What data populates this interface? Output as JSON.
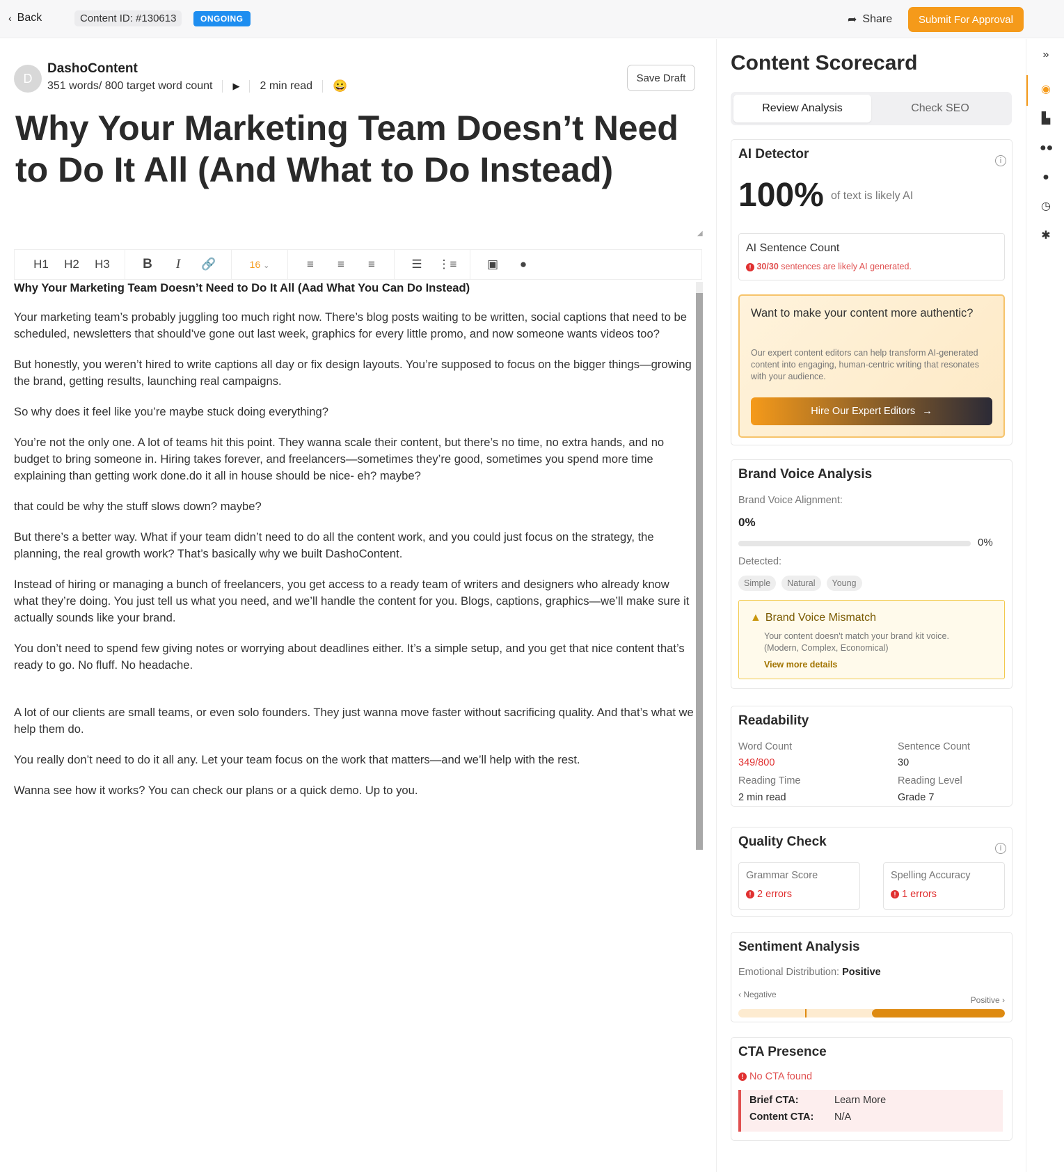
{
  "header": {
    "back_label": "Back",
    "content_id": "Content ID: #130613",
    "status": "ONGOING",
    "share_label": "Share",
    "submit_label": "Submit For Approval"
  },
  "editor": {
    "avatar_letter": "D",
    "author": "DashoContent",
    "word_count": "351 words/ 800 target word count",
    "read_time": "2 min read",
    "emoji": "😀",
    "save_draft": "Save Draft",
    "title": "Why Your Marketing Team Doesn’t Need to Do It All (And What to Do Instead)",
    "toolbar": {
      "h1": "H1",
      "h2": "H2",
      "h3": "H3",
      "bold": "B",
      "italic": "I",
      "font_size": "16"
    },
    "body_heading": "Why Your Marketing Team Doesn’t Need to Do It All (Aad What You Can Do Instead)",
    "paragraphs": [
      "Your marketing team’s probably juggling too much right now. There’s blog posts waiting to be written, social captions that need to be scheduled, newsletters that should’ve gone out last week, graphics for every little promo, and now someone wants videos too?",
      "But honestly, you weren’t hired to write captions all day or fix design layouts. You’re supposed to focus on the bigger things—growing the brand, getting results, launching real campaigns.",
      "So why does it feel like you’re maybe stuck doing everything?",
      "You’re not the only one. A lot of teams hit this point. They wanna scale their content, but there’s no time, no extra hands, and no budget to bring someone in. Hiring takes forever, and freelancers—sometimes they’re good, sometimes you spend more time explaining than getting work done.do it all in house should be nice- eh? maybe?",
      "that could be why the stuff slows down? maybe?",
      "But there’s a better way. What if your team didn’t need to do all the content work, and you could just focus on the strategy, the planning, the real growth work? That’s basically why we built DashoContent.",
      "Instead of hiring or managing a bunch of freelancers, you get access to a ready team of writers and designers who already know what they’re doing. You just tell us what you need, and we’ll handle the content for you. Blogs, captions, graphics—we’ll make sure it actually sounds like your brand.",
      "You don’t need to spend few giving notes or worrying about deadlines either. It’s a simple setup, and you get that nice content that’s ready to go. No fluff. No headache.",
      "A lot of our clients are small teams, or even solo founders. They just wanna move faster without sacrificing quality. And that’s what we help them do.",
      "You really don’t need to do it all any. Let your team focus on the work that matters—and we’ll help with the rest.",
      "Wanna see how it works? You can check our plans or  a quick demo. Up to you."
    ]
  },
  "scorecard": {
    "title": "Content Scorecard",
    "tabs": [
      "Review Analysis",
      "Check SEO"
    ],
    "ai_detector": {
      "title": "AI Detector",
      "percent": "100%",
      "percent_label": "of text is likely AI",
      "sentence_count_label": "AI Sentence Count",
      "sentence_count_value": "30/30",
      "sentence_count_note": "sentences are likely AI generated.",
      "promo_title": "Want to make your content more authentic?",
      "promo_text": "Our expert content editors can help transform AI-generated content into engaging, human-centric writing that resonates with your audience.",
      "promo_button": "Hire Our Expert Editors"
    },
    "brand_voice": {
      "title": "Brand Voice Analysis",
      "alignment_label": "Brand Voice Alignment:",
      "alignment_value": "0%",
      "bar_label": "0%",
      "bar_fraction": 0,
      "detected_label": "Detected:",
      "tags": [
        "Simple",
        "Natural",
        "Young"
      ],
      "mismatch_title": "Brand Voice Mismatch",
      "mismatch_text": "Your content doesn't match your brand kit voice.",
      "mismatch_kit": "(Modern, Complex, Economical)",
      "mismatch_link": "View more details"
    },
    "readability": {
      "title": "Readability",
      "word_count_label": "Word Count",
      "word_count_value": "349/800",
      "sentence_count_label": "Sentence Count",
      "sentence_count_value": "30",
      "reading_time_label": "Reading Time",
      "reading_time_value": "2 min read",
      "reading_level_label": "Reading Level",
      "reading_level_value": "Grade 7"
    },
    "quality": {
      "title": "Quality Check",
      "grammar_label": "Grammar Score",
      "grammar_value": "2 errors",
      "spelling_label": "Spelling Accuracy",
      "spelling_value": "1 errors"
    },
    "sentiment": {
      "title": "Sentiment Analysis",
      "distribution_label": "Emotional Distribution:",
      "distribution_value": "Positive",
      "negative_label": "‹ Negative",
      "positive_label": "Positive ›",
      "positive_fraction": 0.5
    },
    "cta": {
      "title": "CTA Presence",
      "status": "No CTA found",
      "brief_label": "Brief CTA:",
      "brief_value": "Learn More",
      "content_label": "Content CTA:",
      "content_value": "N/A"
    }
  },
  "colors": {
    "accent": "#f59a1a",
    "status_blue": "#1e8ef0",
    "error_red": "#e03030",
    "sentiment_positive": "#de8a10"
  },
  "icons": {
    "rail": [
      "collapse-icon",
      "scorecard-icon",
      "book-icon",
      "users-icon",
      "chat-icon",
      "clock-icon",
      "settings-icon"
    ]
  }
}
